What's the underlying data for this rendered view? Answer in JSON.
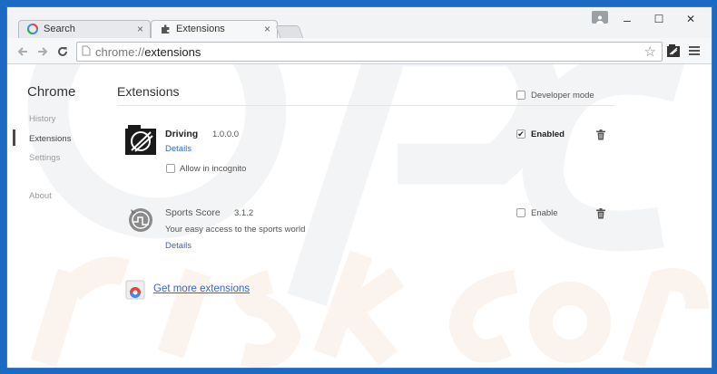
{
  "tabs": [
    {
      "label": "Search",
      "close": "×"
    },
    {
      "label": "Extensions",
      "close": "×"
    }
  ],
  "window_controls": {
    "minimize": "–",
    "maximize": "☐",
    "close": "✕"
  },
  "address": {
    "scheme": "chrome://",
    "path": "extensions"
  },
  "sidebar": {
    "title": "Chrome",
    "items": [
      "History",
      "Extensions",
      "Settings",
      "About"
    ]
  },
  "page": {
    "title": "Extensions",
    "developer_mode": "Developer mode"
  },
  "extensions": [
    {
      "name": "Driving",
      "version": "1.0.0.0",
      "details": "Details",
      "incognito": "Allow in incognito",
      "status": "Enabled",
      "checked": true
    },
    {
      "name": "Sports Score",
      "version": "3.1.2",
      "description": "Your easy access to the sports world",
      "details": "Details",
      "status": "Enable",
      "checked": false
    }
  ],
  "more_link": "Get more extensions"
}
